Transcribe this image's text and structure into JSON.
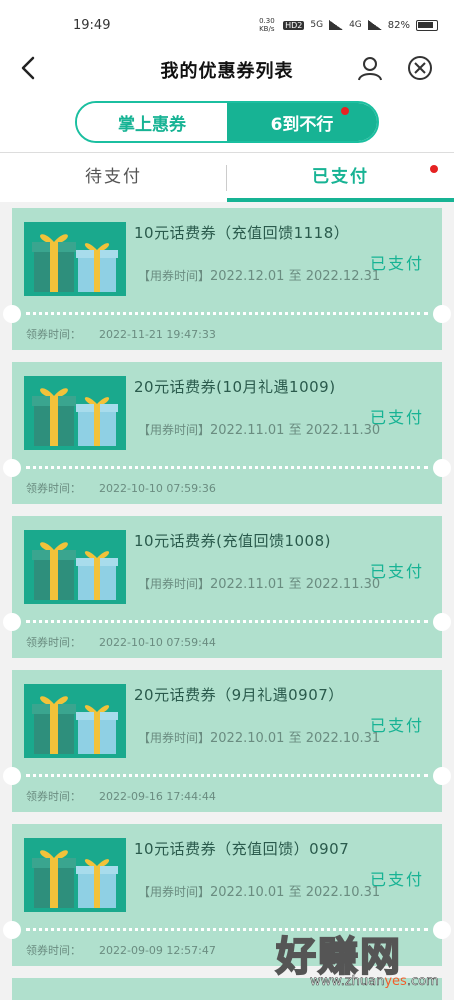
{
  "status_bar": {
    "time": "19:49",
    "net_speed": "0.30 KB/s",
    "hd": "HD2",
    "net1": "5G",
    "net2": "4G",
    "battery": "82%"
  },
  "nav": {
    "title": "我的优惠券列表"
  },
  "toggle": {
    "left": "掌上惠券",
    "right": "6到不行"
  },
  "tabs": {
    "unpaid": "待支付",
    "paid": "已支付"
  },
  "coupons": [
    {
      "title": "10元话费券（充值回馈1118）",
      "status": "已支付",
      "use_label": "【用券时间】",
      "use_time": "2022.12.01 至 2022.12.31",
      "get_label": "领券时间：",
      "get_time": "2022-11-21 19:47:33"
    },
    {
      "title": "20元话费券(10月礼遇1009)",
      "status": "已支付",
      "use_label": "【用券时间】",
      "use_time": "2022.11.01 至 2022.11.30",
      "get_label": "领券时间：",
      "get_time": "2022-10-10 07:59:36"
    },
    {
      "title": "10元话费券(充值回馈1008)",
      "status": "已支付",
      "use_label": "【用券时间】",
      "use_time": "2022.11.01 至 2022.11.30",
      "get_label": "领券时间：",
      "get_time": "2022-10-10 07:59:44"
    },
    {
      "title": "20元话费券（9月礼遇0907）",
      "status": "已支付",
      "use_label": "【用券时间】",
      "use_time": "2022.10.01 至 2022.10.31",
      "get_label": "领券时间：",
      "get_time": "2022-09-16 17:44:44"
    },
    {
      "title": "10元话费券（充值回馈）0907",
      "status": "已支付",
      "use_label": "【用券时间】",
      "use_time": "2022.10.01 至 2022.10.31",
      "get_label": "领券时间：",
      "get_time": "2022-09-09 12:57:47"
    }
  ],
  "watermark": {
    "brand": "好赚网",
    "url_a": "www.zhuan",
    "url_b": "yes",
    "url_c": ".com"
  },
  "colors": {
    "accent": "#17b394",
    "card": "#b0e0cd",
    "badge": "#e52222"
  }
}
